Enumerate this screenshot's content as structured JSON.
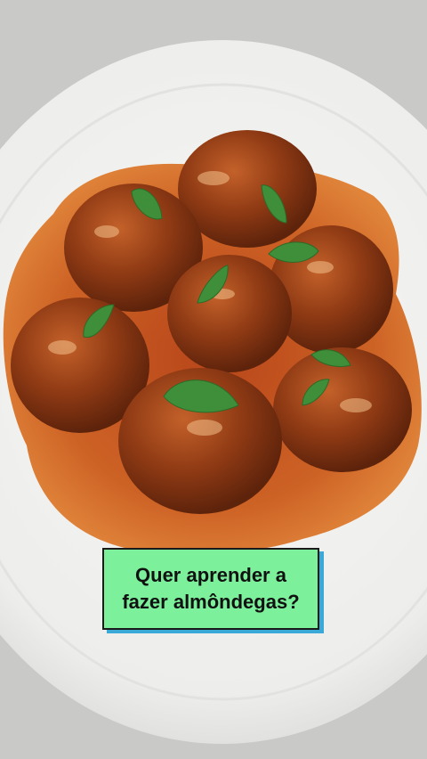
{
  "caption": {
    "line1": "Quer aprender a",
    "line2": "fazer almôndegas?"
  },
  "colors": {
    "background": "#c9c9c7",
    "plate": "#f3f3f1",
    "sauce": "#c85a1e",
    "meatball": "#8f3a14",
    "basil": "#3f8f3a",
    "caption_bg": "#7cf09a",
    "caption_shadow": "#3ba9d8"
  },
  "image": {
    "subject": "meatballs-in-tomato-sauce-with-basil-on-white-plate"
  }
}
